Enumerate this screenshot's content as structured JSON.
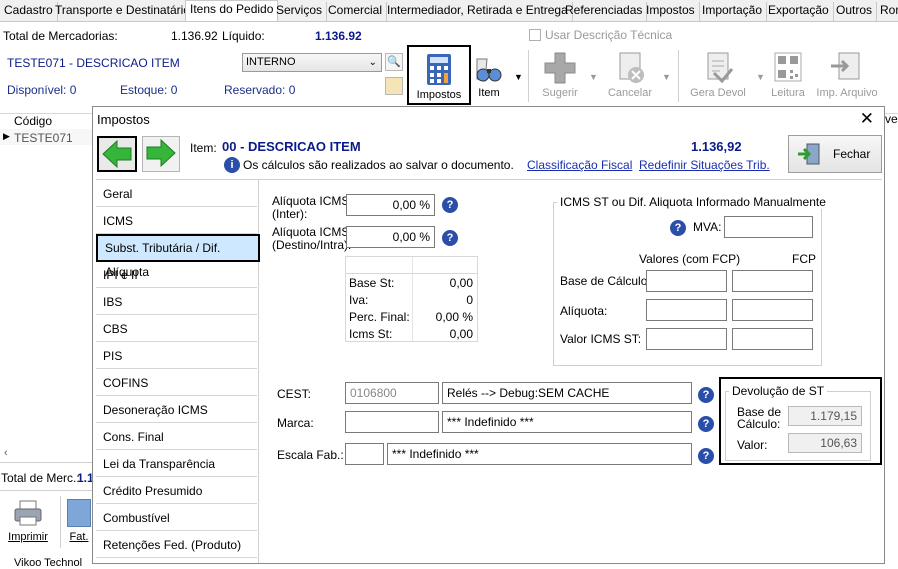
{
  "tabs": [
    "Cadastro",
    "Transporte e Destinatário",
    "Itens do Pedido",
    "Serviços",
    "Comercial",
    "Intermediador, Retirada e Entrega",
    "Referenciadas",
    "Impostos",
    "Importação",
    "Exportação",
    "Outros",
    "Rom"
  ],
  "header": {
    "total_merc_label": "Total de Mercadorias:",
    "total_merc_value": "1.136.92",
    "liquido_label": "Líquido:",
    "liquido_value": "1.136.92",
    "usar_desc_label": "Usar Descrição Técnica",
    "item_desc": "TESTE071 - DESCRICAO ITEM",
    "select_value": "INTERNO",
    "disponivel": "Disponível: 0",
    "estoque": "Estoque: 0",
    "reservado": "Reservado: 0"
  },
  "toolbar": {
    "impostos": "Impostos",
    "item": "Item",
    "sugerir": "Sugerir",
    "cancelar": "Cancelar",
    "gera_devol": "Gera Devol",
    "leitura": "Leitura",
    "imp_arquivo": "Imp. Arquivo"
  },
  "grid": {
    "col_codigo": "Código",
    "row_codigo": "TESTE071",
    "right_frag": "ve"
  },
  "bottom": {
    "total_merc": "Total de Merc.:",
    "total_value": "1.1",
    "imprimir": "Imprimir",
    "fat": "Fat.",
    "status": "Vikoo Technol"
  },
  "modal": {
    "title": "Impostos",
    "item_label": "Item:",
    "item_value": "00 - DESCRICAO ITEM",
    "item_total": "1.136,92",
    "info": "Os cálculos são realizados ao salvar o documento.",
    "link_classificacao": "Classificação Fiscal",
    "link_redefinir": "Redefinir Situações Trib.",
    "fechar": "Fechar",
    "nav": [
      "Geral",
      "ICMS",
      "Subst. Tributária / Dif. Alíquota",
      "IPI e II",
      "IBS",
      "CBS",
      "PIS",
      "COFINS",
      "Desoneração ICMS",
      "Cons. Final",
      "Lei da Transparência",
      "Crédito Presumido",
      "Combustível",
      "Retenções Fed. (Produto)"
    ],
    "aliq_inter_label_1": "Alíquota ICMS",
    "aliq_inter_label_2": "(Inter):",
    "aliq_inter_value": "0,00 %",
    "aliq_destino_label_1": "Alíquota ICMS",
    "aliq_destino_label_2": "(Destino/Intra):",
    "aliq_destino_value": "0,00 %",
    "st_rows": [
      {
        "label": "Base St:",
        "value": "0,00"
      },
      {
        "label": "Iva:",
        "value": "0"
      },
      {
        "label": "Perc. Final:",
        "value": "0,00 %"
      },
      {
        "label": "Icms St:",
        "value": "0,00"
      }
    ],
    "manual_title": "ICMS ST ou Dif. Aliquota Informado Manualmente",
    "mva_label": "MVA:",
    "valores_fcp": "Valores (com FCP)",
    "fcp": "FCP",
    "base_calc": "Base de Cálculo:",
    "aliquota": "Alíquota:",
    "valor_icms_st": "Valor ICMS ST:",
    "cest_label": "CEST:",
    "cest_value": "0106800",
    "cest_desc": "Relés   --> Debug:SEM CACHE",
    "marca_label": "Marca:",
    "marca_desc": "*** Indefinido ***",
    "escala_label": "Escala Fab.:",
    "escala_desc": "*** Indefinido ***",
    "devolucao_title": "Devolução de  ST",
    "dev_base_label_1": "Base de",
    "dev_base_label_2": "Cálculo:",
    "dev_base_value": "1.179,15",
    "dev_valor_label": "Valor:",
    "dev_valor_value": "106,63"
  }
}
